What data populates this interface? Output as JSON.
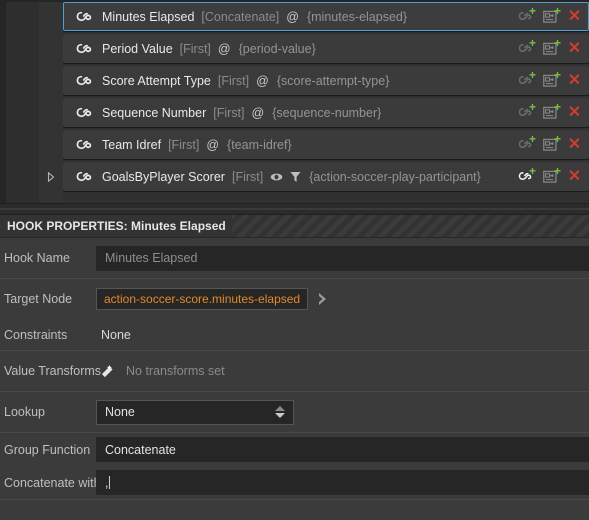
{
  "hook_list": {
    "rows": [
      {
        "icon": "hook-link-icon",
        "name": "Minutes Elapsed",
        "function": "[Concatenate]",
        "at": "@",
        "path": "{minutes-elapsed}",
        "selected": true,
        "has_expander": false,
        "has_eye": false,
        "has_filter": false,
        "link_active": false
      },
      {
        "icon": "hook-link-icon",
        "name": "Period Value",
        "function": "[First]",
        "at": "@",
        "path": "{period-value}",
        "selected": false,
        "has_expander": false,
        "has_eye": false,
        "has_filter": false,
        "link_active": false
      },
      {
        "icon": "hook-link-icon",
        "name": "Score Attempt Type",
        "function": "[First]",
        "at": "@",
        "path": "{score-attempt-type}",
        "selected": false,
        "has_expander": false,
        "has_eye": false,
        "has_filter": false,
        "link_active": false
      },
      {
        "icon": "hook-link-icon",
        "name": "Sequence Number",
        "function": "[First]",
        "at": "@",
        "path": "{sequence-number}",
        "selected": false,
        "has_expander": false,
        "has_eye": false,
        "has_filter": false,
        "link_active": false
      },
      {
        "icon": "hook-link-icon",
        "name": "Team Idref",
        "function": "[First]",
        "at": "@",
        "path": "{team-idref}",
        "selected": false,
        "has_expander": false,
        "has_eye": false,
        "has_filter": false,
        "link_active": false
      },
      {
        "icon": "hook-link-icon",
        "name": "GoalsByPlayer Scorer",
        "function": "[First]",
        "at": "",
        "path": "{action-soccer-play-participant}",
        "selected": false,
        "has_expander": true,
        "has_eye": true,
        "has_filter": true,
        "link_active": true
      }
    ],
    "actions": {
      "link_tooltip": "add-link",
      "node_tooltip": "add-node",
      "delete_label": "✕"
    }
  },
  "properties": {
    "header_title": "HOOK PROPERTIES: Minutes Elapsed",
    "hook_name": {
      "label": "Hook Name",
      "value": "Minutes Elapsed"
    },
    "target_node": {
      "label": "Target Node",
      "value": "action-soccer-score.minutes-elapsed"
    },
    "constraints": {
      "label": "Constraints",
      "value": "None"
    },
    "value_transforms": {
      "label": "Value Transforms",
      "value": "No transforms set"
    },
    "lookup": {
      "label": "Lookup",
      "value": "None"
    },
    "group_function": {
      "label": "Group Function",
      "value": "Concatenate"
    },
    "concatenate_with": {
      "label": "Concatenate with",
      "value": ","
    }
  },
  "colors": {
    "accent_selection": "#4a9fd4",
    "target_node_text": "#e08b2c",
    "delete_red": "#cf3b35",
    "plus_green": "#6fc34b"
  }
}
